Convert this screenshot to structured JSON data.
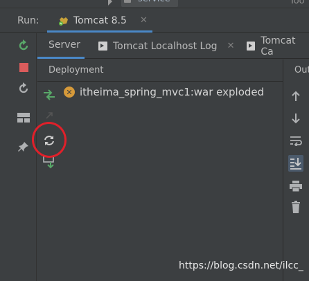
{
  "top_strip": {
    "service_label": "service",
    "right_label": "Too"
  },
  "run_bar": {
    "run_label": "Run:",
    "config_tab": {
      "title": "Tomcat 8.5",
      "close": "✕"
    }
  },
  "left_toolbar": {
    "items": [
      "rerun-icon",
      "stop-icon",
      "restart-icon",
      "layout-icon",
      "pin-icon"
    ]
  },
  "tabs": [
    {
      "label": "Server",
      "active": true
    },
    {
      "label": "Tomcat Localhost Log",
      "close": "✕"
    },
    {
      "label": "Tomcat Ca",
      "truncated": true
    }
  ],
  "deployment": {
    "header": "Deployment",
    "artifacts": [
      {
        "name": "itheima_spring_mvc1:war exploded",
        "status": "error"
      }
    ],
    "toolbar": [
      "deploy-all-icon",
      "undeploy-icon",
      "redeploy-icon",
      "deploy-to-server-icon"
    ]
  },
  "output": {
    "header": "Out",
    "toolbar": [
      "up-arrow-icon",
      "down-arrow-icon",
      "soft-wrap-icon",
      "scroll-to-end-icon",
      "print-icon",
      "clear-icon"
    ]
  },
  "watermark": "https://blog.csdn.net/ilcc_",
  "colors": {
    "background": "#3c3f41",
    "accent": "#4a88c7",
    "green": "#59a869",
    "red": "#e0202a",
    "warning": "#d69a3a"
  }
}
